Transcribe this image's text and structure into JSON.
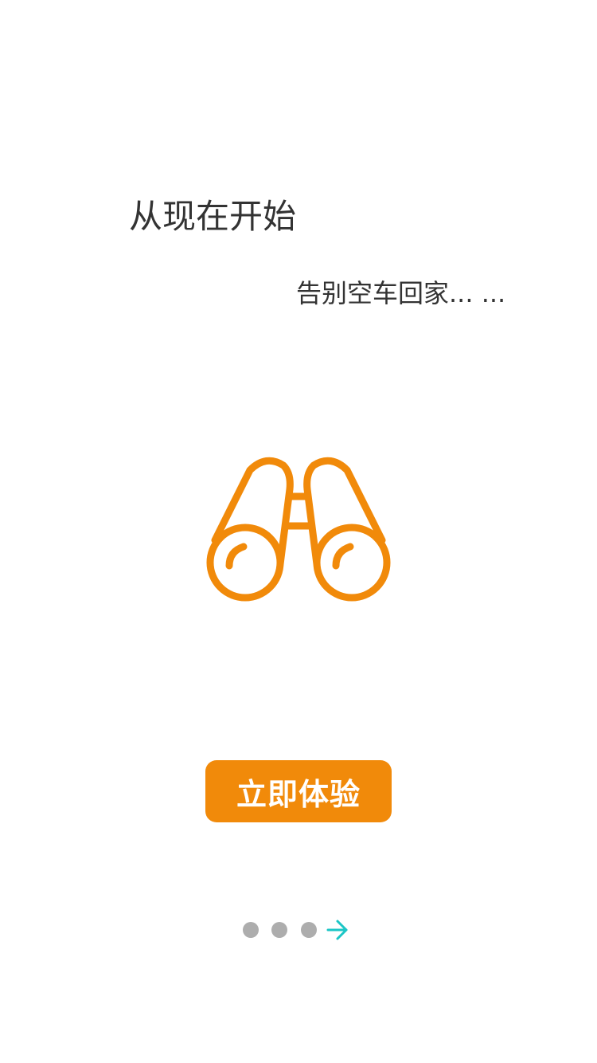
{
  "intro": {
    "headline": "从现在开始",
    "subline": "告别空车回家... ..."
  },
  "illustration": {
    "icon": "binoculars-icon",
    "color": "#f18a0a"
  },
  "cta": {
    "label": "立即体验",
    "color": "#f18a0a"
  },
  "pager": {
    "dots": 3,
    "dot_color": "#adadad",
    "next_icon": "arrow-right-icon",
    "next_color": "#1cc6c6"
  }
}
